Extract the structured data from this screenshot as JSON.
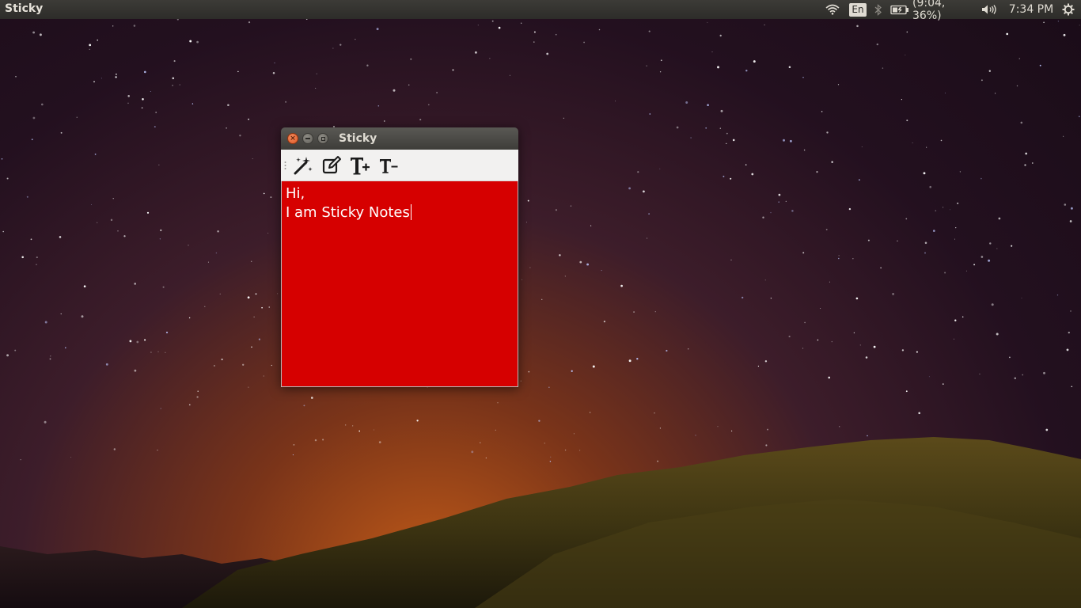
{
  "panel": {
    "app_title": "Sticky",
    "language": "En",
    "battery": "(9:04, 36%)",
    "clock": "7:34 PM"
  },
  "icons": {
    "wifi": "wifi-icon",
    "bluetooth": "bluetooth-icon",
    "battery": "battery-icon",
    "volume": "volume-icon",
    "settings": "gear-icon"
  },
  "window": {
    "title": "Sticky",
    "toolbar": [
      {
        "name": "new-note-button",
        "icon": "magic-wand-icon"
      },
      {
        "name": "edit-button",
        "icon": "edit-icon"
      },
      {
        "name": "increase-font-button",
        "icon": "text-increase-icon",
        "label": "T+"
      },
      {
        "name": "decrease-font-button",
        "icon": "text-decrease-icon",
        "label": "T-"
      }
    ],
    "note_color": "#d60000",
    "note_lines": [
      "Hi,",
      "I am Sticky Notes"
    ]
  }
}
